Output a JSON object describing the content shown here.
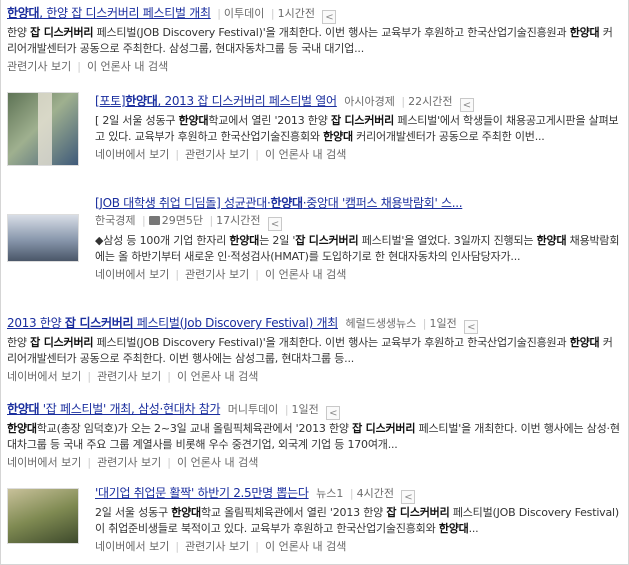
{
  "items": [
    {
      "title_pre": "",
      "title_bold": "한양대",
      "title_post": ", 한양 잡 디스커버리 페스티벌 개최",
      "source": "이투데이",
      "time": "1시간전",
      "desc_html": "한양 <b>잡 디스커버리</b> 페스티벌(JOB Discovery Festival)'을 개최한다. 이번 행사는 교육부가 후원하고 한국산업기술진흥원과 <b>한양대</b> 커리어개발센터가 공동으로 주최한다. 삼성그룹, 현대자동차그룹 등 국내 대기업...",
      "links": [
        "관련기사 보기",
        "이 언론사 내 검색"
      ]
    },
    {
      "title_pre": "[포토]",
      "title_bold": "한양대",
      "title_post": ", 2013 잡 디스커버리 페스티벌 열어",
      "source": "아시아경제",
      "time": "22시간전",
      "desc_html": "[ 2일 서울 성동구 <b>한양대</b>학교에서 열린 '2013 한양 <b>잡 디스커버리</b> 페스티벌'에서 학생들이 채용공고게시판을 살펴보고 있다. 교육부가 후원하고 한국산업기술진흥회와 <b>한양대</b> 커리어개발센터가 공동으로 주최한 이번...",
      "links": [
        "네이버에서 보기",
        "관련기사 보기",
        "이 언론사 내 검색"
      ]
    },
    {
      "title_pre": "[JOB 대학생 취업 디딤돌] 성균관대·",
      "title_bold": "한양대",
      "title_post": "·중앙대 '캠퍼스 채용박람회' 스...",
      "source": "한국경제",
      "photo": "29면5단",
      "time": "17시간전",
      "desc_html": "◆삼성 등 100개 기업 한자리 <b>한양대</b>는 2일 '<b>잡 디스커버리</b> 페스티벌'을 열었다. 3일까지 진행되는 <b>한양대</b> 채용박람회에는 올 하반기부터 새로운 인·적성검사(HMAT)를 도입하기로 한 현대자동차의 인사담당자가...",
      "links": [
        "네이버에서 보기",
        "관련기사 보기",
        "이 언론사 내 검색"
      ]
    },
    {
      "title_pre": "2013 한양 ",
      "title_bold": "잡 디스커버리",
      "title_post": " 페스티벌(Job Discovery Festival) 개최",
      "source": "헤럴드생생뉴스",
      "time": "1일전",
      "desc_html": "한양 <b>잡 디스커버리</b> 페스티벌(JOB Discovery Festival)'을 개최한다. 이번 행사는 교육부가 후원하고 한국산업기술진흥원과 <b>한양대</b> 커리어개발센터가 공동으로 주최한다. 이번 행사에는 삼성그룹, 현대차그룹 등...",
      "links": [
        "네이버에서 보기",
        "관련기사 보기",
        "이 언론사 내 검색"
      ]
    },
    {
      "title_pre": "",
      "title_bold": "한양대",
      "title_post": " '잡 페스티벌' 개최, 삼성·현대차 참가",
      "source": "머니투데이",
      "time": "1일전",
      "desc_html": "<b>한양대</b>학교(총장 임덕호)가 오는 2~3일 교내 올림픽체육관에서 '2013 한양 <b>잡 디스커버리</b> 페스티벌'을 개최한다. 이번 행사에는 삼성·현대차그룹 등 국내 주요 그룹 계열사를 비롯해 우수 중견기업, 외국계 기업 등 170여개...",
      "links": [
        "네이버에서 보기",
        "관련기사 보기",
        "이 언론사 내 검색"
      ]
    },
    {
      "title_pre": "'대기업 취업문 활짝' 하반기 2.5만명 뽑는다",
      "title_bold": "",
      "title_post": "",
      "source": "뉴스1",
      "time": "4시간전",
      "desc_html": "2일 서울 성동구 <b>한양대</b>학교 올림픽체육관에서 열린 '2013 한양 <b>잡 디스커버리</b> 페스티벌(JOB Discovery Festival)이 취업준비생들로 북적이고 있다. 교육부가 후원하고 한국산업기술진흥회와 <b>한양대</b>...",
      "links": [
        "네이버에서 보기",
        "관련기사 보기",
        "이 언론사 내 검색"
      ]
    }
  ],
  "share_icon": "share-icon",
  "thumb_colors": [
    "#7e8f78",
    "#9aa7b5",
    "#8c9a6a"
  ]
}
